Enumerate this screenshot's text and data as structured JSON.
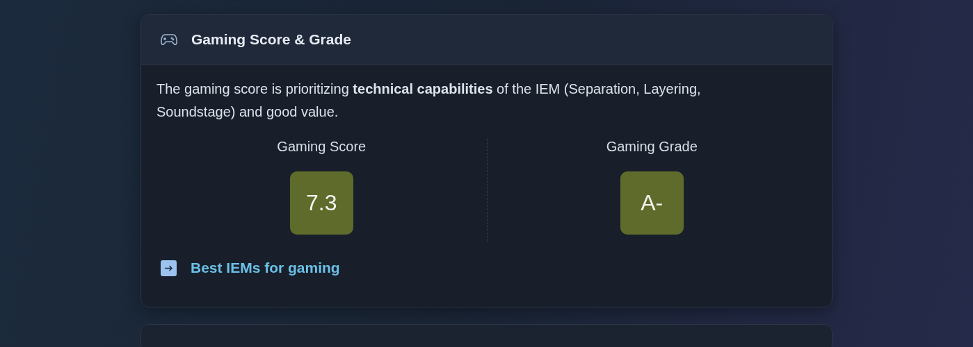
{
  "card": {
    "title": "Gaming Score & Grade",
    "description": "The gaming score is prioritizing **technical capabilities** of the IEM (Separation, Layering, Soundstage) and good value.",
    "metrics": [
      {
        "label": "Gaming Score",
        "value": "7.3",
        "color": "#5f6b2a"
      },
      {
        "label": "Gaming Grade",
        "value": "A-",
        "color": "#5f6b2a"
      }
    ],
    "link": {
      "label": "Best IEMs for gaming"
    }
  }
}
